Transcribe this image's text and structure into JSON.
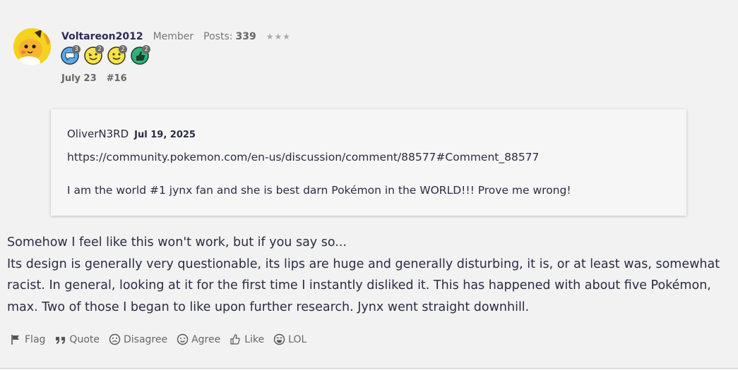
{
  "author": {
    "username": "Voltareon2012",
    "role": "Member",
    "posts_label": "Posts:",
    "posts_count": "339",
    "stars": "★★★",
    "avatar_icon": "raichu-avatar-icon"
  },
  "badges": [
    {
      "icon": "speech-bubble-badge-icon",
      "count": "3",
      "color": "#5aa9e6"
    },
    {
      "icon": "wink-face-badge-icon",
      "count": "2",
      "color": "#f7e34b"
    },
    {
      "icon": "smile-face-badge-icon",
      "count": "2",
      "color": "#f7e34b"
    },
    {
      "icon": "thumbs-up-badge-icon",
      "count": "2",
      "color": "#2bb37a"
    }
  ],
  "post_meta": {
    "date": "July 23",
    "number": "#16"
  },
  "quote": {
    "author": "OliverN3RD",
    "date": "Jul 19, 2025",
    "link": "https://community.pokemon.com/en-us/discussion/comment/88577#Comment_88577",
    "text": "I am the world #1 jynx fan and she is best darn Pokémon in the WORLD!!! Prove me wrong!"
  },
  "body": {
    "line1": "Somehow I feel like this won't work, but if you say so...",
    "para2": "Its design is generally very questionable, its lips are huge and generally disturbing, it is, or at least was, somewhat racist. In general, looking at it for the first time I instantly disliked it. This has happened with about five Pokémon, max. Two of those I began to like upon further research. Jynx went straight downhill."
  },
  "actions": {
    "flag": "Flag",
    "quote": "Quote",
    "disagree": "Disagree",
    "agree": "Agree",
    "like": "Like",
    "lol": "LOL"
  }
}
